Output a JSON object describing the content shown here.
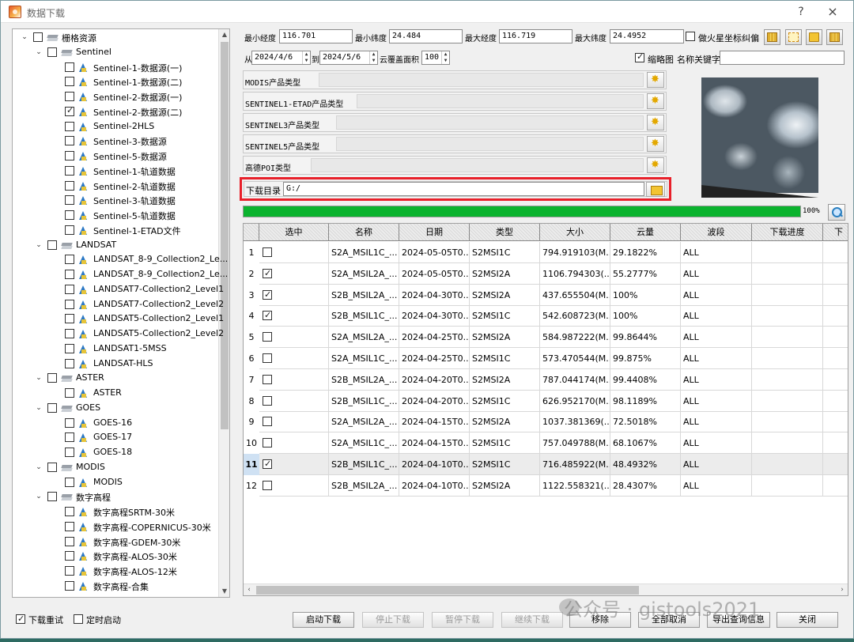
{
  "window": {
    "title": "数据下载",
    "help": "?",
    "close": "×"
  },
  "tree": [
    {
      "label": "栅格资源",
      "indent": 0,
      "type": "folder",
      "expanded": true,
      "checked": false
    },
    {
      "label": "Sentinel",
      "indent": 1,
      "type": "folder",
      "expanded": true,
      "checked": false
    },
    {
      "label": "Sentinel-1-数据源(一)",
      "indent": 2,
      "type": "leaf",
      "checked": false
    },
    {
      "label": "Sentinel-1-数据源(二)",
      "indent": 2,
      "type": "leaf",
      "checked": false
    },
    {
      "label": "Sentinel-2-数据源(一)",
      "indent": 2,
      "type": "leaf",
      "checked": false
    },
    {
      "label": "Sentinel-2-数据源(二)",
      "indent": 2,
      "type": "leaf",
      "checked": true
    },
    {
      "label": "Sentinel-2HLS",
      "indent": 2,
      "type": "leaf",
      "checked": false
    },
    {
      "label": "Sentinel-3-数据源",
      "indent": 2,
      "type": "leaf",
      "checked": false
    },
    {
      "label": "Sentinel-5-数据源",
      "indent": 2,
      "type": "leaf",
      "checked": false
    },
    {
      "label": "Sentinel-1-轨道数据",
      "indent": 2,
      "type": "leaf",
      "checked": false
    },
    {
      "label": "Sentinel-2-轨道数据",
      "indent": 2,
      "type": "leaf",
      "checked": false
    },
    {
      "label": "Sentinel-3-轨道数据",
      "indent": 2,
      "type": "leaf",
      "checked": false
    },
    {
      "label": "Sentinel-5-轨道数据",
      "indent": 2,
      "type": "leaf",
      "checked": false
    },
    {
      "label": "Sentinel-1-ETAD文件",
      "indent": 2,
      "type": "leaf",
      "checked": false
    },
    {
      "label": "LANDSAT",
      "indent": 1,
      "type": "folder",
      "expanded": true,
      "checked": false
    },
    {
      "label": "LANDSAT_8-9_Collection2_Le...",
      "indent": 2,
      "type": "leaf",
      "checked": false
    },
    {
      "label": "LANDSAT_8-9_Collection2_Le...",
      "indent": 2,
      "type": "leaf",
      "checked": false
    },
    {
      "label": "LANDSAT7-Collection2_Level1",
      "indent": 2,
      "type": "leaf",
      "checked": false
    },
    {
      "label": "LANDSAT7-Collection2_Level2",
      "indent": 2,
      "type": "leaf",
      "checked": false
    },
    {
      "label": "LANDSAT5-Collection2_Level1",
      "indent": 2,
      "type": "leaf",
      "checked": false
    },
    {
      "label": "LANDSAT5-Collection2_Level2",
      "indent": 2,
      "type": "leaf",
      "checked": false
    },
    {
      "label": "LANDSAT1-5MSS",
      "indent": 2,
      "type": "leaf",
      "checked": false
    },
    {
      "label": "LANDSAT-HLS",
      "indent": 2,
      "type": "leaf",
      "checked": false
    },
    {
      "label": "ASTER",
      "indent": 1,
      "type": "folder",
      "expanded": true,
      "checked": false
    },
    {
      "label": "ASTER",
      "indent": 2,
      "type": "leaf",
      "checked": false
    },
    {
      "label": "GOES",
      "indent": 1,
      "type": "folder",
      "expanded": true,
      "checked": false
    },
    {
      "label": "GOES-16",
      "indent": 2,
      "type": "leaf",
      "checked": false
    },
    {
      "label": "GOES-17",
      "indent": 2,
      "type": "leaf",
      "checked": false
    },
    {
      "label": "GOES-18",
      "indent": 2,
      "type": "leaf",
      "checked": false
    },
    {
      "label": "MODIS",
      "indent": 1,
      "type": "folder",
      "expanded": true,
      "checked": false
    },
    {
      "label": "MODIS",
      "indent": 2,
      "type": "leaf",
      "checked": false
    },
    {
      "label": "数字高程",
      "indent": 1,
      "type": "folder",
      "expanded": true,
      "checked": false
    },
    {
      "label": "数字高程SRTM-30米",
      "indent": 2,
      "type": "leaf",
      "checked": false
    },
    {
      "label": "数字高程-COPERNICUS-30米",
      "indent": 2,
      "type": "leaf",
      "checked": false
    },
    {
      "label": "数字高程-GDEM-30米",
      "indent": 2,
      "type": "leaf",
      "checked": false
    },
    {
      "label": "数字高程-ALOS-30米",
      "indent": 2,
      "type": "leaf",
      "checked": false
    },
    {
      "label": "数字高程-ALOS-12米",
      "indent": 2,
      "type": "leaf",
      "checked": false
    },
    {
      "label": "数字高程-合集",
      "indent": 2,
      "type": "leaf",
      "checked": false
    }
  ],
  "query": {
    "min_lon_label": "最小经度",
    "min_lon": "116.701",
    "min_lat_label": "最小纬度",
    "min_lat": "24.484",
    "max_lon_label": "最大经度",
    "max_lon": "116.719",
    "max_lat_label": "最大纬度",
    "max_lat": "24.4952",
    "mars_label": "做火星坐标纠偏",
    "mars_checked": false,
    "from_label": "从",
    "from_date": "2024/4/6",
    "to_label": "到",
    "to_date": "2024/5/6",
    "cloud_label": "云覆盖面积",
    "cloud_value": "100",
    "thumbnail_label": "缩略图",
    "thumbnail_checked": true,
    "keyword_label": "名称关键字",
    "keyword_value": ""
  },
  "product_types": [
    {
      "label": "MODIS产品类型"
    },
    {
      "label": "SENTINEL1-ETAD产品类型"
    },
    {
      "label": "SENTINEL3产品类型"
    },
    {
      "label": "SENTINEL5产品类型"
    },
    {
      "label": "高德POI类型"
    }
  ],
  "download_dir": {
    "label": "下载目录",
    "value": "G:/"
  },
  "progress": {
    "percent": 100,
    "text": "100%"
  },
  "table": {
    "headers": [
      "选中",
      "名称",
      "日期",
      "类型",
      "大小",
      "云量",
      "波段",
      "下载进度",
      "下"
    ],
    "rows": [
      {
        "n": "1",
        "checked": false,
        "name": "S2A_MSIL1C_...",
        "date": "2024-05-05T0...",
        "type": "S2MSI1C",
        "size": "794.919103(M...",
        "cloud": "29.1822%",
        "band": "ALL",
        "progress": ""
      },
      {
        "n": "2",
        "checked": true,
        "name": "S2A_MSIL2A_...",
        "date": "2024-05-05T0...",
        "type": "S2MSI2A",
        "size": "1106.794303(...",
        "cloud": "55.2777%",
        "band": "ALL",
        "progress": ""
      },
      {
        "n": "3",
        "checked": true,
        "name": "S2B_MSIL2A_...",
        "date": "2024-04-30T0...",
        "type": "S2MSI2A",
        "size": "437.655504(M...",
        "cloud": "100%",
        "band": "ALL",
        "progress": ""
      },
      {
        "n": "4",
        "checked": true,
        "name": "S2B_MSIL1C_...",
        "date": "2024-04-30T0...",
        "type": "S2MSI1C",
        "size": "542.608723(M...",
        "cloud": "100%",
        "band": "ALL",
        "progress": ""
      },
      {
        "n": "5",
        "checked": false,
        "name": "S2A_MSIL2A_...",
        "date": "2024-04-25T0...",
        "type": "S2MSI2A",
        "size": "584.987222(M...",
        "cloud": "99.8644%",
        "band": "ALL",
        "progress": ""
      },
      {
        "n": "6",
        "checked": false,
        "name": "S2A_MSIL1C_...",
        "date": "2024-04-25T0...",
        "type": "S2MSI1C",
        "size": "573.470544(M...",
        "cloud": "99.875%",
        "band": "ALL",
        "progress": ""
      },
      {
        "n": "7",
        "checked": false,
        "name": "S2B_MSIL2A_...",
        "date": "2024-04-20T0...",
        "type": "S2MSI2A",
        "size": "787.044174(M...",
        "cloud": "99.4408%",
        "band": "ALL",
        "progress": ""
      },
      {
        "n": "8",
        "checked": false,
        "name": "S2B_MSIL1C_...",
        "date": "2024-04-20T0...",
        "type": "S2MSI1C",
        "size": "626.952170(M...",
        "cloud": "98.1189%",
        "band": "ALL",
        "progress": ""
      },
      {
        "n": "9",
        "checked": false,
        "name": "S2A_MSIL2A_...",
        "date": "2024-04-15T0...",
        "type": "S2MSI2A",
        "size": "1037.381369(...",
        "cloud": "72.5018%",
        "band": "ALL",
        "progress": ""
      },
      {
        "n": "10",
        "checked": false,
        "name": "S2A_MSIL1C_...",
        "date": "2024-04-15T0...",
        "type": "S2MSI1C",
        "size": "757.049788(M...",
        "cloud": "68.1067%",
        "band": "ALL",
        "progress": ""
      },
      {
        "n": "11",
        "checked": true,
        "name": "S2B_MSIL1C_...",
        "date": "2024-04-10T0...",
        "type": "S2MSI1C",
        "size": "716.485922(M...",
        "cloud": "48.4932%",
        "band": "ALL",
        "progress": "",
        "selected": true
      },
      {
        "n": "12",
        "checked": false,
        "name": "S2B_MSIL2A_...",
        "date": "2024-04-10T0...",
        "type": "S2MSI2A",
        "size": "1122.558321(...",
        "cloud": "28.4307%",
        "band": "ALL",
        "progress": ""
      }
    ]
  },
  "bottom": {
    "retry_label": "下载重试",
    "retry_checked": true,
    "timer_label": "定时启动",
    "timer_checked": false,
    "buttons": [
      {
        "label": "启动下载",
        "disabled": false
      },
      {
        "label": "停止下载",
        "disabled": true
      },
      {
        "label": "暂停下载",
        "disabled": true
      },
      {
        "label": "继续下载",
        "disabled": true
      },
      {
        "label": "移除",
        "disabled": false
      },
      {
        "label": "全部取消",
        "disabled": false
      },
      {
        "label": "导出查询信息",
        "disabled": false
      },
      {
        "label": "关闭",
        "disabled": false
      }
    ]
  },
  "watermark": "公众号 · gistools2021"
}
